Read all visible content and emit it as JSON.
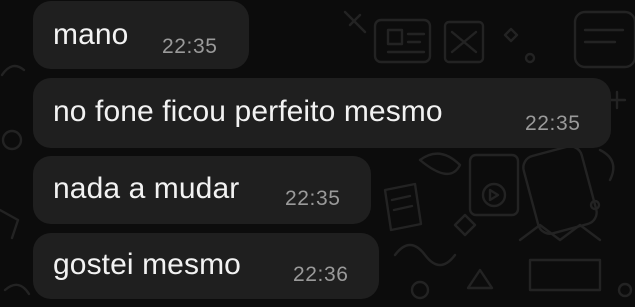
{
  "chat": {
    "messages": [
      {
        "text": "mano",
        "time": "22:35"
      },
      {
        "text": "no fone ficou perfeito mesmo",
        "time": "22:35"
      },
      {
        "text": "nada a mudar",
        "time": "22:35"
      },
      {
        "text": "gostei mesmo",
        "time": "22:36"
      }
    ]
  },
  "colors": {
    "background": "#0c0c0c",
    "bubble": "#1f1f1f",
    "text": "#f2f2f2",
    "timestamp": "#9a9a9a",
    "wallpaper_doodle": "#232323"
  }
}
